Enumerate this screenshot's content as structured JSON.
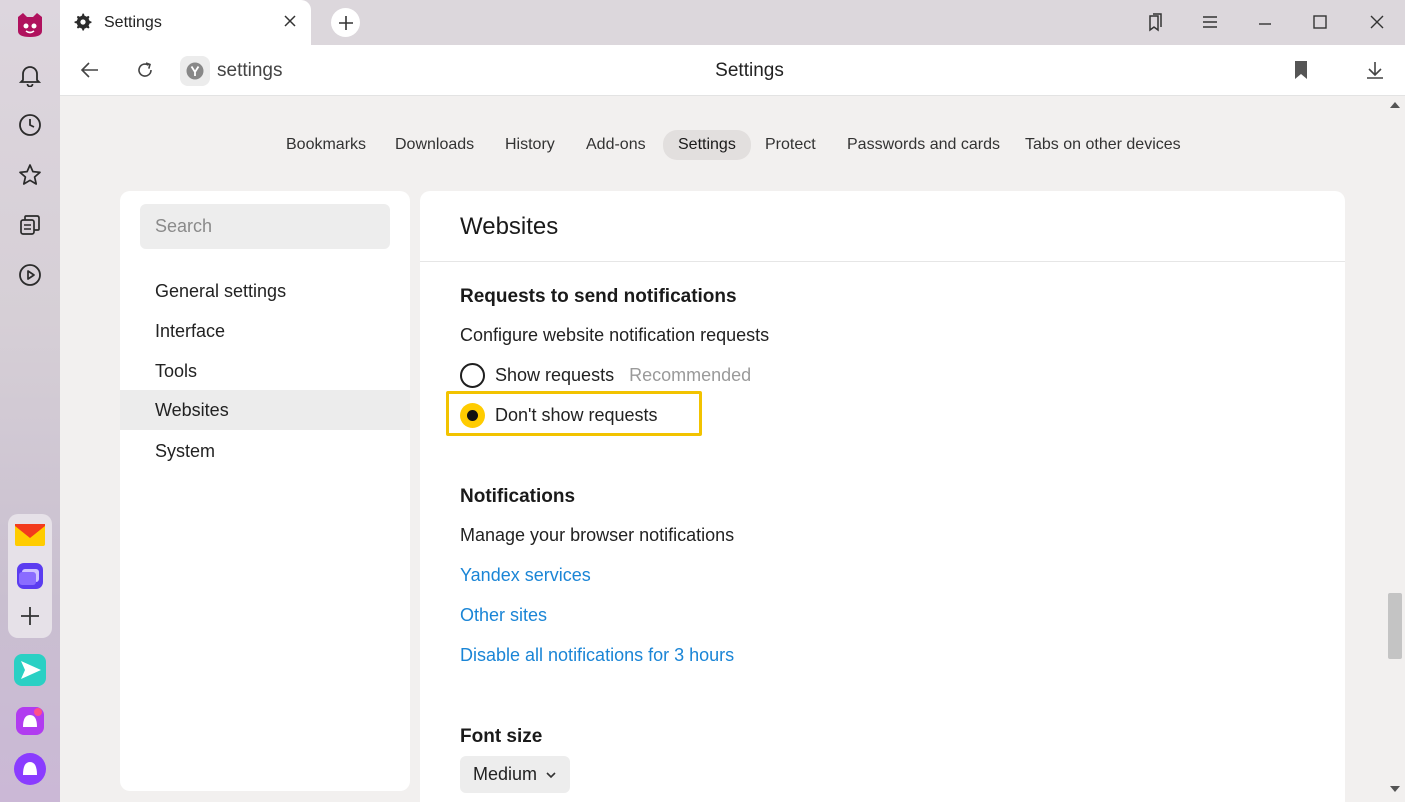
{
  "tab": {
    "title": "Settings"
  },
  "address": {
    "url": "settings",
    "page_title": "Settings"
  },
  "nav": {
    "items": [
      "Bookmarks",
      "Downloads",
      "History",
      "Add-ons",
      "Settings",
      "Protect",
      "Passwords and cards",
      "Tabs on other devices"
    ],
    "active": "Settings"
  },
  "sidebar": {
    "search_placeholder": "Search",
    "items": [
      "General settings",
      "Interface",
      "Tools",
      "Websites",
      "System"
    ],
    "active": "Websites"
  },
  "main": {
    "title": "Websites",
    "requests": {
      "heading": "Requests to send notifications",
      "description": "Configure website notification requests",
      "option_show": "Show requests",
      "option_show_badge": "Recommended",
      "option_dont_show": "Don't show requests",
      "selected": "Don't show requests"
    },
    "notifications": {
      "heading": "Notifications",
      "description": "Manage your browser notifications",
      "links": [
        "Yandex services",
        "Other sites",
        "Disable all notifications for 3 hours"
      ]
    },
    "font": {
      "heading": "Font size",
      "value": "Medium"
    }
  },
  "colors": {
    "accent_yellow": "#ffcc00",
    "highlight_border": "#f2c300",
    "link_blue": "#1a85d6"
  },
  "icons": [
    "app-logo-icon",
    "bell-icon",
    "clock-icon",
    "star-icon",
    "collections-icon",
    "play-icon",
    "mail-icon",
    "messenger-icon",
    "plus-icon",
    "send-icon",
    "alice-app-icon",
    "alice-icon",
    "gear-icon",
    "close-icon",
    "bookmarks-panel-icon",
    "menu-icon",
    "minimize-icon",
    "maximize-icon",
    "back-icon",
    "reload-icon",
    "bookmark-icon",
    "download-icon",
    "chevron-down-icon"
  ]
}
